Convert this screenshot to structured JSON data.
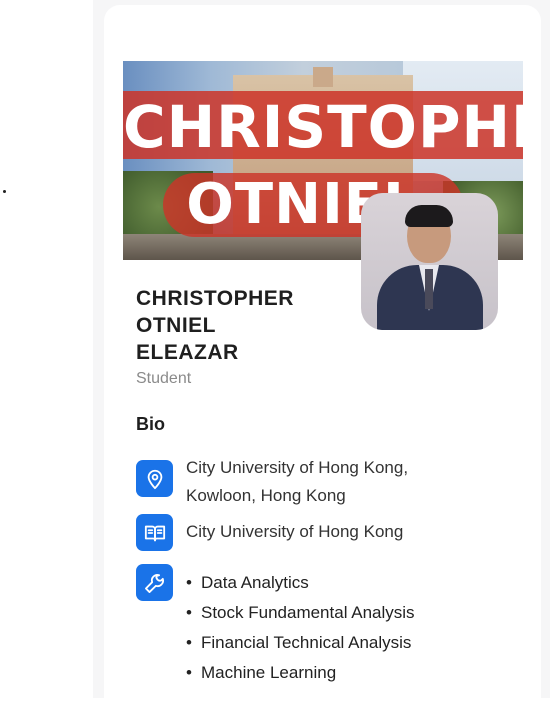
{
  "banner": {
    "title_line1": "CHRISTOPHER",
    "title_line2": "OTNIEL"
  },
  "profile": {
    "name_lines": [
      "CHRISTOPHER",
      "OTNIEL",
      "ELEAZAR"
    ],
    "role": "Student",
    "bio_heading": "Bio"
  },
  "info": {
    "location_icon": "location-pin-icon",
    "location_line1": "City University of Hong Kong,",
    "location_line2": "Kowloon, Hong Kong",
    "school_icon": "open-book-icon",
    "school": "City University of Hong Kong",
    "skills_icon": "wrench-icon",
    "skills": [
      "Data Analytics",
      "Stock Fundamental Analysis",
      "Financial Technical Analysis",
      "Machine Learning"
    ],
    "bullet": "•"
  },
  "colors": {
    "accent": "#1a73e8",
    "banner_red": "#cc3428"
  }
}
